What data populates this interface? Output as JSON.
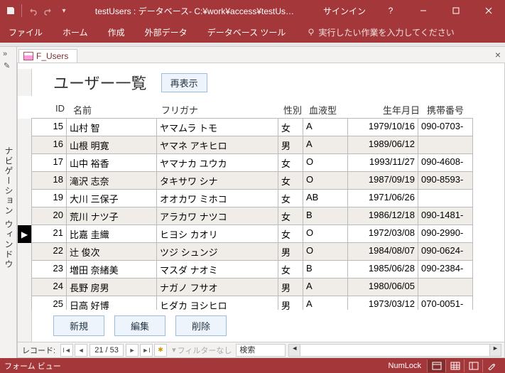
{
  "title": "testUsers : データベース- C:¥work¥access¥testUs…",
  "signin": "サインイン",
  "ribbon": {
    "file": "ファイル",
    "home": "ホーム",
    "create": "作成",
    "external": "外部データ",
    "dbtools": "データベース ツール",
    "tellme": "実行したい作業を入力してください"
  },
  "navpane": {
    "label": "ナビゲーション ウィンドウ"
  },
  "tab": {
    "name": "F_Users"
  },
  "form": {
    "title": "ユーザー一覧",
    "refresh": "再表示",
    "new": "新規",
    "edit": "編集",
    "delete": "削除"
  },
  "columns": {
    "id": "ID",
    "name": "名前",
    "kana": "フリガナ",
    "sex": "性別",
    "blood": "血液型",
    "birth": "生年月日",
    "phone": "携帯番号"
  },
  "rows": [
    {
      "id": "15",
      "name": "山村 智",
      "kana": "ヤマムラ トモ",
      "sex": "女",
      "blood": "A",
      "birth": "1979/10/16",
      "phone": "090-0703-"
    },
    {
      "id": "16",
      "name": "山根 明寛",
      "kana": "ヤマネ アキヒロ",
      "sex": "男",
      "blood": "A",
      "birth": "1989/06/12",
      "phone": ""
    },
    {
      "id": "17",
      "name": "山中 裕香",
      "kana": "ヤマナカ ユウカ",
      "sex": "女",
      "blood": "O",
      "birth": "1993/11/27",
      "phone": "090-4608-"
    },
    {
      "id": "18",
      "name": "滝沢 志奈",
      "kana": "タキサワ シナ",
      "sex": "女",
      "blood": "O",
      "birth": "1987/09/19",
      "phone": "090-8593-"
    },
    {
      "id": "19",
      "name": "大川 三保子",
      "kana": "オオカワ ミホコ",
      "sex": "女",
      "blood": "AB",
      "birth": "1971/06/26",
      "phone": ""
    },
    {
      "id": "20",
      "name": "荒川 ナツ子",
      "kana": "アラカワ ナツコ",
      "sex": "女",
      "blood": "B",
      "birth": "1986/12/18",
      "phone": "090-1481-"
    },
    {
      "id": "21",
      "name": "比嘉 圭織",
      "kana": "ヒヨシ カオリ",
      "sex": "女",
      "blood": "O",
      "birth": "1972/03/08",
      "phone": "090-2990-"
    },
    {
      "id": "22",
      "name": "辻 俊次",
      "kana": "ツジ シュンジ",
      "sex": "男",
      "blood": "O",
      "birth": "1984/08/07",
      "phone": "090-0624-"
    },
    {
      "id": "23",
      "name": "増田 奈緒美",
      "kana": "マスダ ナオミ",
      "sex": "女",
      "blood": "B",
      "birth": "1985/06/28",
      "phone": "090-2384-"
    },
    {
      "id": "24",
      "name": "長野 房男",
      "kana": "ナガノ フサオ",
      "sex": "男",
      "blood": "A",
      "birth": "1980/06/05",
      "phone": ""
    },
    {
      "id": "25",
      "name": "日高 好博",
      "kana": "ヒダカ ヨシヒロ",
      "sex": "男",
      "blood": "A",
      "birth": "1973/03/12",
      "phone": "070-0051-"
    }
  ],
  "current_row_index": 6,
  "recnav": {
    "label": "レコード:",
    "pos": "21 / 53",
    "filter": "フィルターなし",
    "search": "検索"
  },
  "status": {
    "view": "フォーム ビュー",
    "numlock": "NumLock"
  }
}
